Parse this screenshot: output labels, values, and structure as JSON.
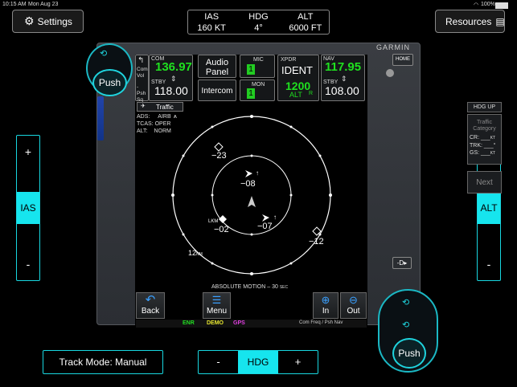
{
  "status_bar": {
    "time": "10:15 AM",
    "date": "Mon Aug 23",
    "battery": "100%"
  },
  "top": {
    "settings_label": "Settings",
    "resources_label": "Resources"
  },
  "gauges": [
    {
      "label": "IAS",
      "value": "160 KT"
    },
    {
      "label": "HDG",
      "value": "4°"
    },
    {
      "label": "ALT",
      "value": "6000 FT"
    }
  ],
  "bezel": {
    "brand": "GARMIN",
    "home_label": "HOME"
  },
  "left_knob": {
    "push_label": "Push",
    "vol_label": "Com Vol",
    "psh_label": "- Psh Sq"
  },
  "right_knob": {
    "push_label": "Push"
  },
  "radios": {
    "com_label": "COM",
    "com_active": "136.97",
    "com_stby_label": "STBY",
    "com_stby": "118.00",
    "audio_panel": "Audio Panel",
    "intercom": "Intercom",
    "mic_label": "MIC",
    "mic_value": "1",
    "mon_label": "MON",
    "mon_value": "1",
    "xpdr_label": "XPDR",
    "xpdr_ident": "IDENT",
    "xpdr_code": "1200",
    "xpdr_mode": "ALT",
    "xpdr_r": "R",
    "nav_label": "NAV",
    "nav_active": "117.95",
    "nav_stby_label": "STBY",
    "nav_stby": "108.00"
  },
  "traffic": {
    "title": "Traffic",
    "ads_label": "ADS:",
    "ads_value": "AIRB",
    "tcas_label": "TCAS:",
    "tcas_value": "OPER",
    "alt_label": "ALT:",
    "alt_value": "NORM",
    "hdg_up": "HDG UP",
    "category_label": "Traffic Category",
    "cr_label": "CR:",
    "cr_value": "___",
    "cr_unit": "KT",
    "trk_label": "TRK:",
    "trk_value": "___",
    "trk_unit": "°",
    "gs_label": "GS:",
    "gs_value": "___",
    "gs_unit": "KT",
    "next_label": "Next",
    "range_label": "12",
    "range_unit": "NM",
    "motion_label": "ABSOLUTE MOTION – 30",
    "motion_unit": "SEC",
    "targets": [
      {
        "label": "−23"
      },
      {
        "label": "−08"
      },
      {
        "label": "−02"
      },
      {
        "label": "−07"
      },
      {
        "label": "−12"
      }
    ]
  },
  "softkeys": {
    "back": "Back",
    "menu": "Menu",
    "in": "In",
    "out": "Out"
  },
  "annunciators": {
    "enr": "ENR",
    "demo": "DEMO",
    "gps": "GPS",
    "hint": "Com Freq / Psh Nav"
  },
  "side": {
    "ias_label": "IAS",
    "alt_label": "ALT",
    "plus": "+",
    "minus": "-"
  },
  "bottom": {
    "track_mode": "Track Mode: Manual",
    "hdg_label": "HDG",
    "minus": "-",
    "plus": "+"
  },
  "colors": {
    "accent": "#16e5ee",
    "freq_green": "#1fe01f",
    "enr": "#22dd22",
    "demo": "#e6e630",
    "gps": "#e040e0"
  }
}
